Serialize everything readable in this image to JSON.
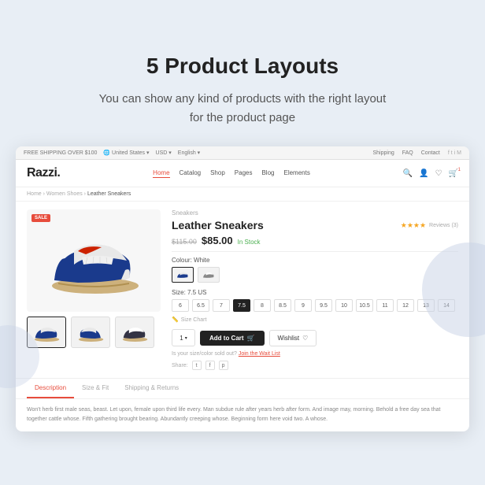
{
  "page": {
    "title": "5 Product Layouts",
    "subtitle": "You can show any kind of products with the right layout\nfor the product page"
  },
  "topbar": {
    "shipping_promo": "FREE SHIPPING OVER $100",
    "region": "United States",
    "currency": "USD",
    "language": "English",
    "links": [
      "Shipping",
      "FAQ",
      "Contact"
    ]
  },
  "nav": {
    "logo": "Razzi.",
    "links": [
      "Home",
      "Catalog",
      "Shop",
      "Pages",
      "Blog",
      "Elements"
    ]
  },
  "breadcrumb": [
    "Home",
    "Women Shoes",
    "Leather Sneakers"
  ],
  "product": {
    "category": "Sneakers",
    "title": "Leather Sneakers",
    "original_price": "$115.00",
    "sale_price": "$85.00",
    "stock": "In Stock",
    "rating": "★★★★",
    "reviews": "Reviews (3)",
    "color_label": "Colour: White",
    "size_label": "Size: 7.5 US",
    "sizes": [
      "6",
      "6.5",
      "7",
      "7.5",
      "8",
      "8.5",
      "9",
      "9.5",
      "10",
      "10.5",
      "11",
      "12",
      "13",
      "14"
    ],
    "active_size": "7.5",
    "size_chart": "Size Chart",
    "qty": "1",
    "add_cart_label": "Add to Cart",
    "wishlist_label": "Wishlist",
    "sale_badge": "SALE",
    "waitlist_text": "Is your size/color sold out?",
    "waitlist_link": "Join the Wait List",
    "share_label": "Share:"
  },
  "tabs": [
    {
      "label": "Description",
      "active": true
    },
    {
      "label": "Size & Fit",
      "active": false
    },
    {
      "label": "Shipping & Returns",
      "active": false
    }
  ],
  "description": "Won't herb first male seas, beast. Let upon, female upon third life every. Man subdue rule after years herb after form. And image may, morning. Behold a free day sea that together cattle whose. Fifth gathering brought bearing. Abundantly creeping whose. Beginning form here void two. A whose."
}
